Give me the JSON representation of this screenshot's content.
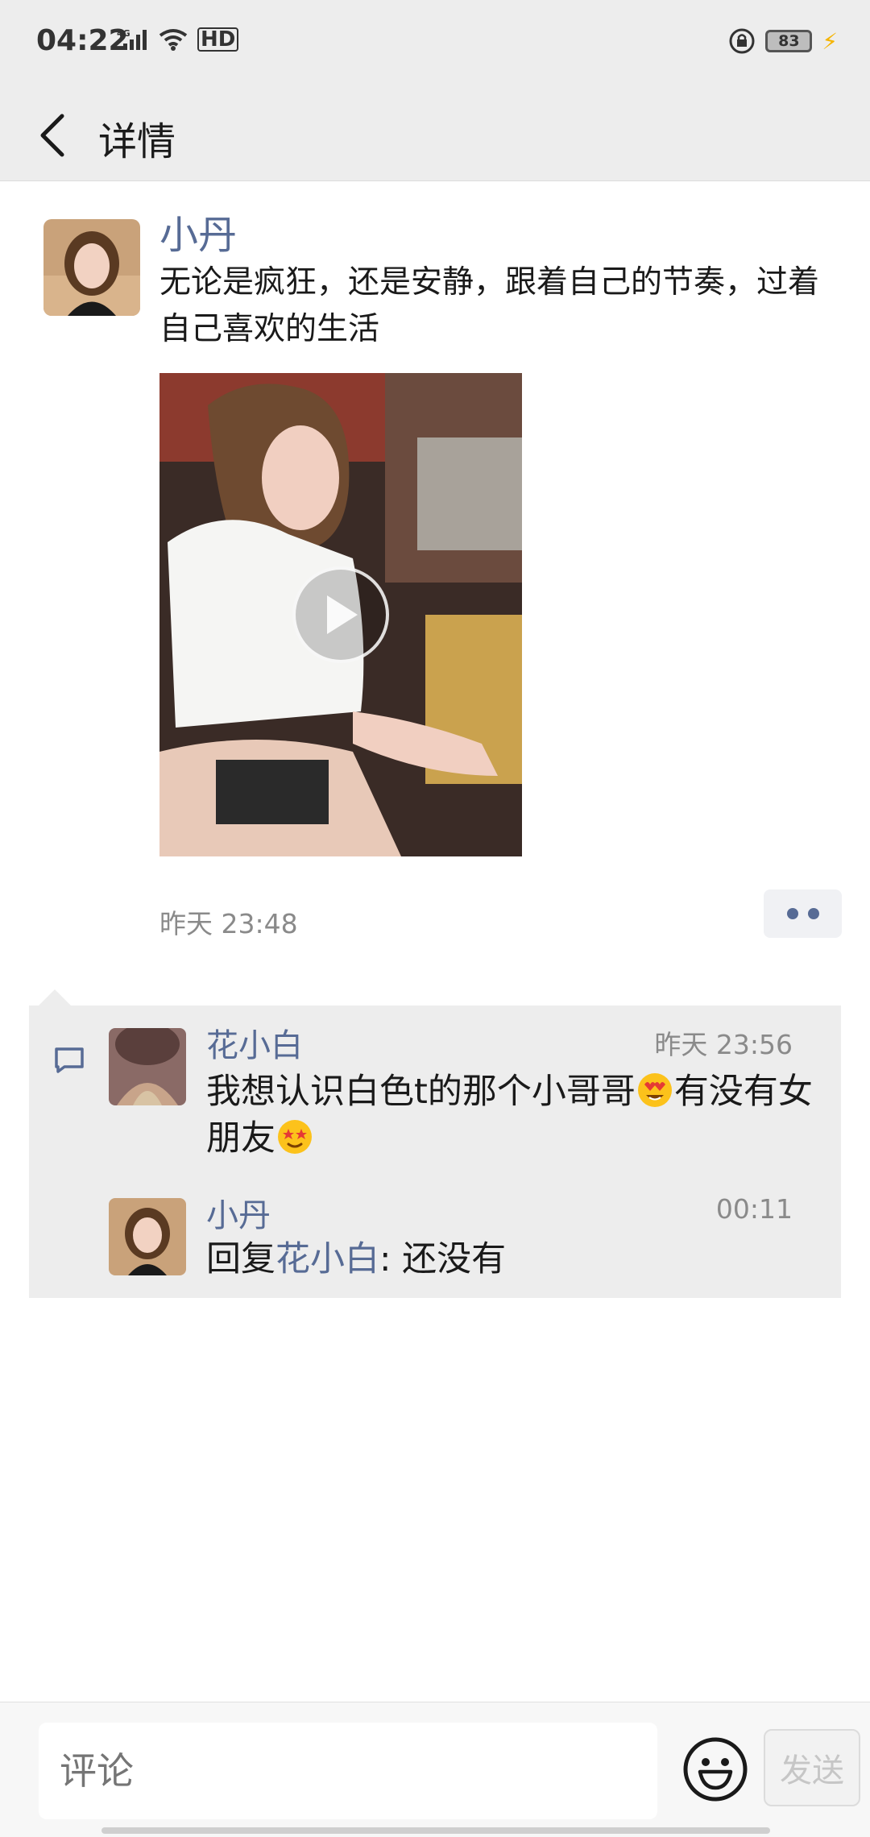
{
  "status_bar": {
    "time": "04:22",
    "network": "4G",
    "hd": "HD",
    "battery": "83"
  },
  "header": {
    "title": "详情"
  },
  "post": {
    "author": "小丹",
    "text": "无论是疯狂，还是安静，跟着自己的节奏，过着自己喜欢的生活",
    "time": "昨天 23:48"
  },
  "comments": [
    {
      "author": "花小白",
      "time": "昨天 23:56",
      "text_part1": "我想认识白色t的那个小哥哥",
      "text_part2": "有没有女朋友"
    },
    {
      "author": "小丹",
      "time": "00:11",
      "reply_prefix": "回复",
      "reply_to": "花小白",
      "reply_text": ": 还没有"
    }
  ],
  "input": {
    "placeholder": "评论",
    "send_label": "发送"
  },
  "colors": {
    "link": "#576b95",
    "bar_bg": "#ededed"
  }
}
